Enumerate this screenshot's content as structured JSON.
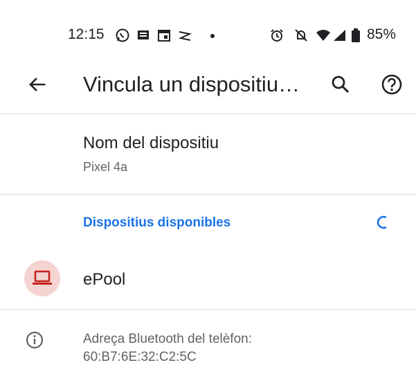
{
  "status_bar": {
    "time": "12:15",
    "battery_percent": "85%",
    "icons": [
      "whatsapp-icon",
      "message-icon",
      "calendar-icon",
      "tidal-icon",
      "dot-icon",
      "alarm-icon",
      "dnd-off-icon",
      "wifi-icon",
      "signal-icon",
      "battery-icon"
    ]
  },
  "app_bar": {
    "title": "Vincula un dispositiu…",
    "back_icon": "arrow-back-icon",
    "search_icon": "search-icon",
    "help_icon": "help-icon"
  },
  "device_name": {
    "title": "Nom del dispositiu",
    "value": "Pixel 4a"
  },
  "available_devices": {
    "title": "Dispositius disponibles",
    "accent_color": "#1a73e8",
    "items": [
      {
        "label": "ePool",
        "icon": "laptop-icon",
        "icon_color": "#c5221f",
        "icon_bg": "#f4d3d0"
      }
    ]
  },
  "bluetooth_info": {
    "label": "Adreça Bluetooth del telèfon:",
    "address": "60:B7:6E:32:C2:5C"
  }
}
